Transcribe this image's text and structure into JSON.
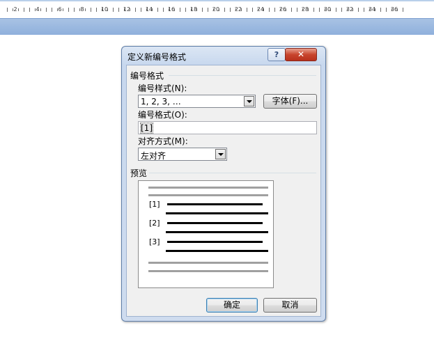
{
  "ruler": {
    "numbers": [
      "2",
      "4",
      "6",
      "8",
      "10",
      "12",
      "14",
      "16",
      "18",
      "20",
      "22",
      "24",
      "26",
      "28",
      "30",
      "32",
      "34",
      "36"
    ]
  },
  "dialog": {
    "title": "定义新编号格式",
    "help_label": "?",
    "close_label": "✕",
    "group_title": "编号格式",
    "number_style_label": "编号样式(N):",
    "number_style_value": "1, 2, 3, …",
    "font_button_label": "字体(F)...",
    "number_format_label": "编号格式(O):",
    "number_format_value": "[1]",
    "alignment_label": "对齐方式(M):",
    "alignment_value": "左对齐",
    "preview_title": "预览",
    "preview_labels": [
      "[1]",
      "[2]",
      "[3]"
    ],
    "ok_label": "确定",
    "cancel_label": "取消"
  }
}
